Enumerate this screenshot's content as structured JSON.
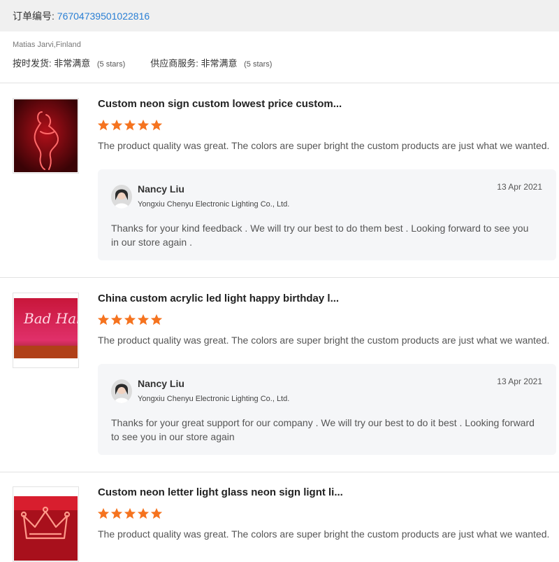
{
  "order": {
    "label": "订单编号:",
    "number": "76704739501022816"
  },
  "buyer": {
    "name": "Matias Jarvi,Finland",
    "ratings": [
      {
        "label": "按时发货:",
        "value": "非常满意",
        "stars": "(5 stars)"
      },
      {
        "label": "供应商服务:",
        "value": "非常满意",
        "stars": "(5 stars)"
      }
    ]
  },
  "colors": {
    "accent_link": "#2a7fd4",
    "star": "#f5731f",
    "reply_bg": "#f5f6f8"
  },
  "reviews": [
    {
      "product_title": "Custom neon sign custom lowest price custom...",
      "rating": 5,
      "text": "The product quality was great. The colors are super bright the custom products are just what we wanted.",
      "thumb_icon": "neon-woman-figure-image",
      "reply": {
        "seller_name": "Nancy Liu",
        "company": "Yongxiu Chenyu Electronic Lighting Co., Ltd.",
        "date": "13 Apr 2021",
        "text": "Thanks for your kind feedback . We will try our best  to do them best . Looking forward to see you in our store again ."
      }
    },
    {
      "product_title": "China custom acrylic led light happy birthday l...",
      "rating": 5,
      "text": "The product quality was great. The colors are super bright the custom products are just what we wanted.",
      "thumb_icon": "neon-bad-habits-image",
      "thumb_text": "Bad Habits",
      "reply": {
        "seller_name": "Nancy Liu",
        "company": "Yongxiu Chenyu Electronic Lighting Co., Ltd.",
        "date": "13 Apr 2021",
        "text": "Thanks for your great support for our company . We will try our best to do it best . Looking forward to see you in our store again"
      }
    },
    {
      "product_title": "Custom neon letter light glass neon sign lignt li...",
      "rating": 5,
      "text": "The product quality was great. The colors are super bright the custom products are just what we wanted.",
      "thumb_icon": "neon-crown-image"
    }
  ]
}
